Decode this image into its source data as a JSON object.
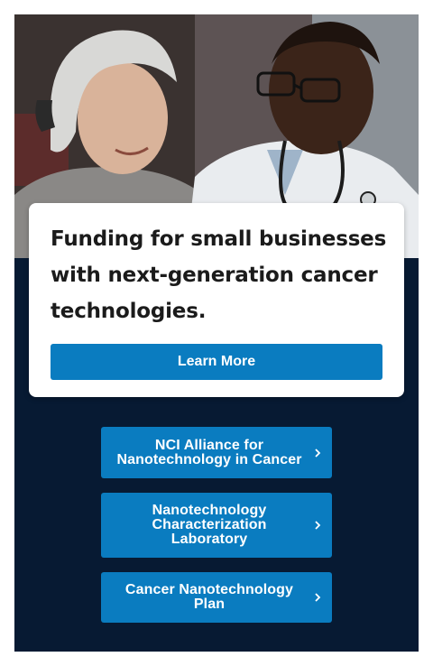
{
  "hero": {
    "image_icon": "photo-patient-and-doctor-icon",
    "headline": "Funding for small businesses with next-generation cancer technologies.",
    "cta_label": "Learn More"
  },
  "links": [
    {
      "label": "NCI Alliance for Nanotechnology in Cancer",
      "icon": "chevron-right-icon"
    },
    {
      "label": "Nanotechnology Characterization Laboratory",
      "icon": "chevron-right-icon"
    },
    {
      "label": "Cancer Nanotechnology Plan",
      "icon": "chevron-right-icon"
    }
  ],
  "colors": {
    "panel_background": "#071a33",
    "button_blue": "#0a7cc0",
    "card_background": "#ffffff",
    "headline_text": "#1b1b1b"
  }
}
